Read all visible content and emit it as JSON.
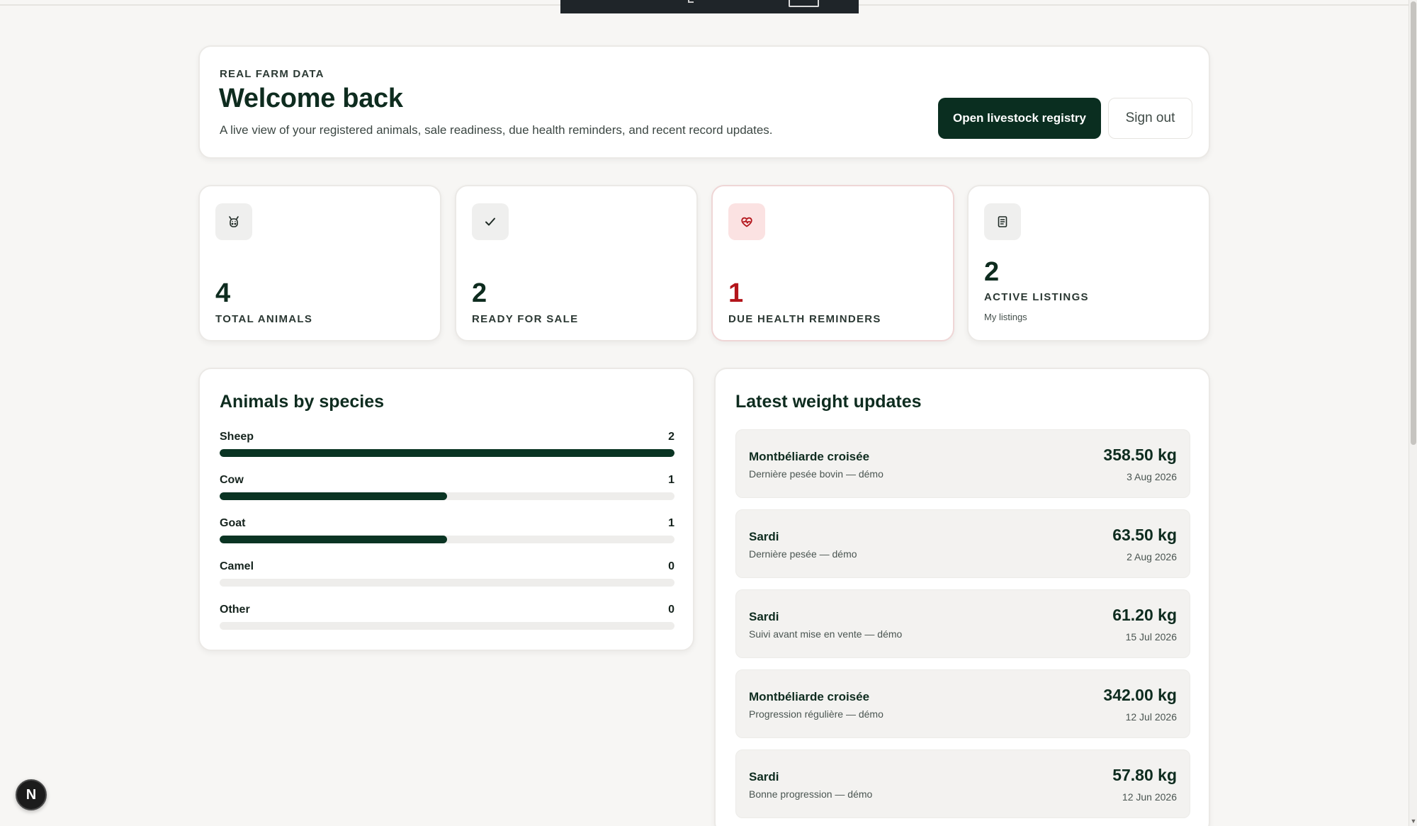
{
  "hero": {
    "eyebrow": "REAL FARM DATA",
    "title": "Welcome back",
    "subtitle": "A live view of your registered animals, sale readiness, due health reminders, and recent record updates.",
    "primary_button": "Open livestock registry",
    "secondary_button": "Sign out"
  },
  "stats": [
    {
      "icon": "cow-face-icon",
      "value": "4",
      "label": "TOTAL ANIMALS"
    },
    {
      "icon": "check-icon",
      "value": "2",
      "label": "READY FOR SALE"
    },
    {
      "icon": "heart-pulse-icon",
      "value": "1",
      "label": "DUE HEALTH REMINDERS",
      "accent": "#b3151b"
    },
    {
      "icon": "document-icon",
      "value": "2",
      "label": "ACTIVE LISTINGS",
      "sub": "My listings"
    }
  ],
  "species": {
    "title": "Animals by species",
    "max": 2,
    "items": [
      {
        "name": "Sheep",
        "count": 2,
        "count_label": "2"
      },
      {
        "name": "Cow",
        "count": 1,
        "count_label": "1"
      },
      {
        "name": "Goat",
        "count": 1,
        "count_label": "1"
      },
      {
        "name": "Camel",
        "count": 0,
        "count_label": "0"
      },
      {
        "name": "Other",
        "count": 0,
        "count_label": "0"
      }
    ]
  },
  "weights": {
    "title": "Latest weight updates",
    "items": [
      {
        "name": "Montbéliarde croisée",
        "note": "Dernière pesée bovin — démo",
        "weight": "358.50 kg",
        "date": "3 Aug 2026"
      },
      {
        "name": "Sardi",
        "note": "Dernière pesée — démo",
        "weight": "63.50 kg",
        "date": "2 Aug 2026"
      },
      {
        "name": "Sardi",
        "note": "Suivi avant mise en vente — démo",
        "weight": "61.20 kg",
        "date": "15 Jul 2026"
      },
      {
        "name": "Montbéliarde croisée",
        "note": "Progression régulière — démo",
        "weight": "342.00 kg",
        "date": "12 Jul 2026"
      },
      {
        "name": "Sardi",
        "note": "Bonne progression — démo",
        "weight": "57.80 kg",
        "date": "12 Jun 2026"
      }
    ]
  },
  "fab_letter": "N",
  "colors": {
    "brand": "#0a2e20",
    "danger": "#b3151b",
    "bar": "#0a3423"
  }
}
